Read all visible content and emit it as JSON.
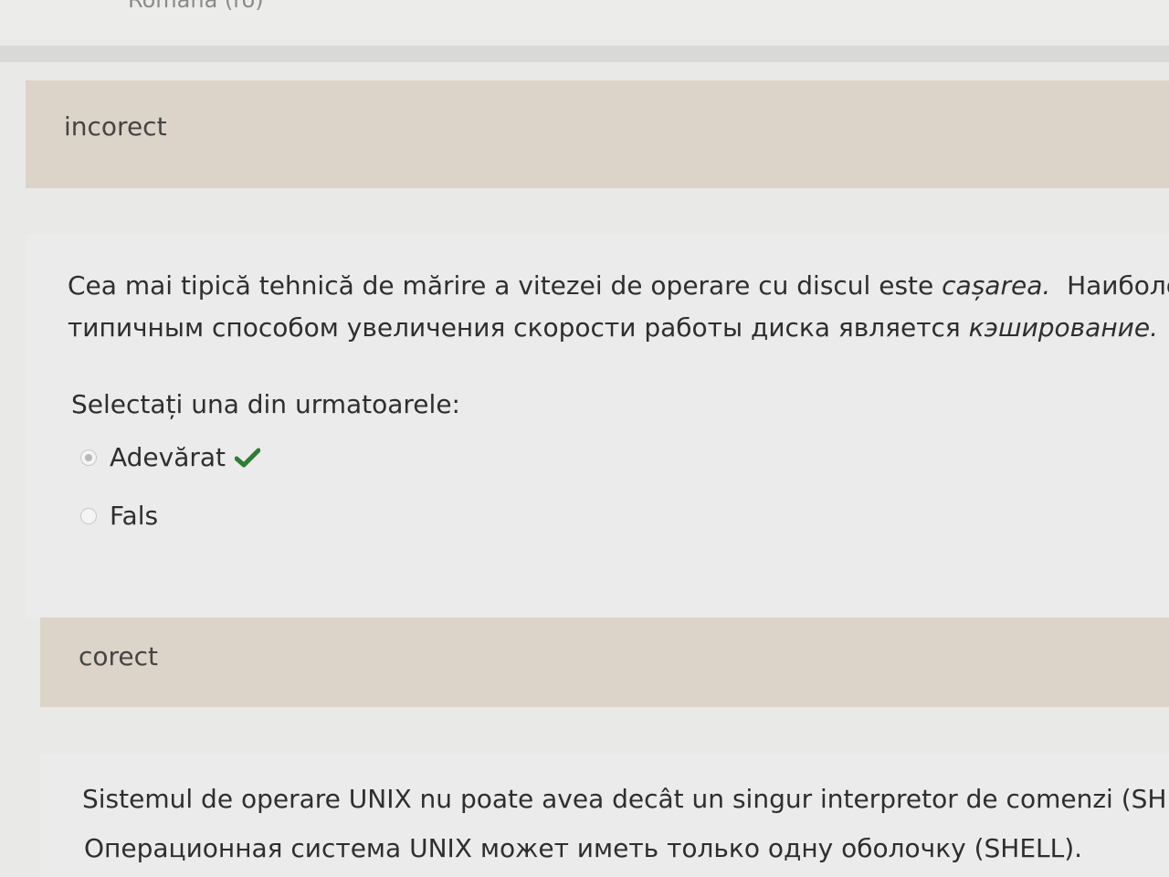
{
  "header": {
    "language_label": "Română (ro)"
  },
  "feedback_1": {
    "text": "incorect"
  },
  "question_1": {
    "text_ro_plain": "Cea mai tipică tehnică de mărire a vitezei de operare cu discul este ",
    "text_ro_em": "cașarea.",
    "text_ru_start": "Наиболее",
    "text_ru_plain": "типичным способом увеличения скорости работы диска является ",
    "text_ru_em": "кэширование.",
    "prompt": "Selectați una din urmatoarele:",
    "options": [
      {
        "label": "Adevărat",
        "selected": true,
        "marked_correct": true
      },
      {
        "label": "Fals",
        "selected": false,
        "marked_correct": false
      }
    ],
    "check_color": "#2e7d32"
  },
  "feedback_2": {
    "text": "corect"
  },
  "question_2": {
    "text_ro": "Sistemul de operare UNIX nu poate avea decât un singur interpretor de comenzi (SHELL).",
    "text_ru": "Операционная система UNIX может иметь только одну оболочку (SHELL)."
  }
}
